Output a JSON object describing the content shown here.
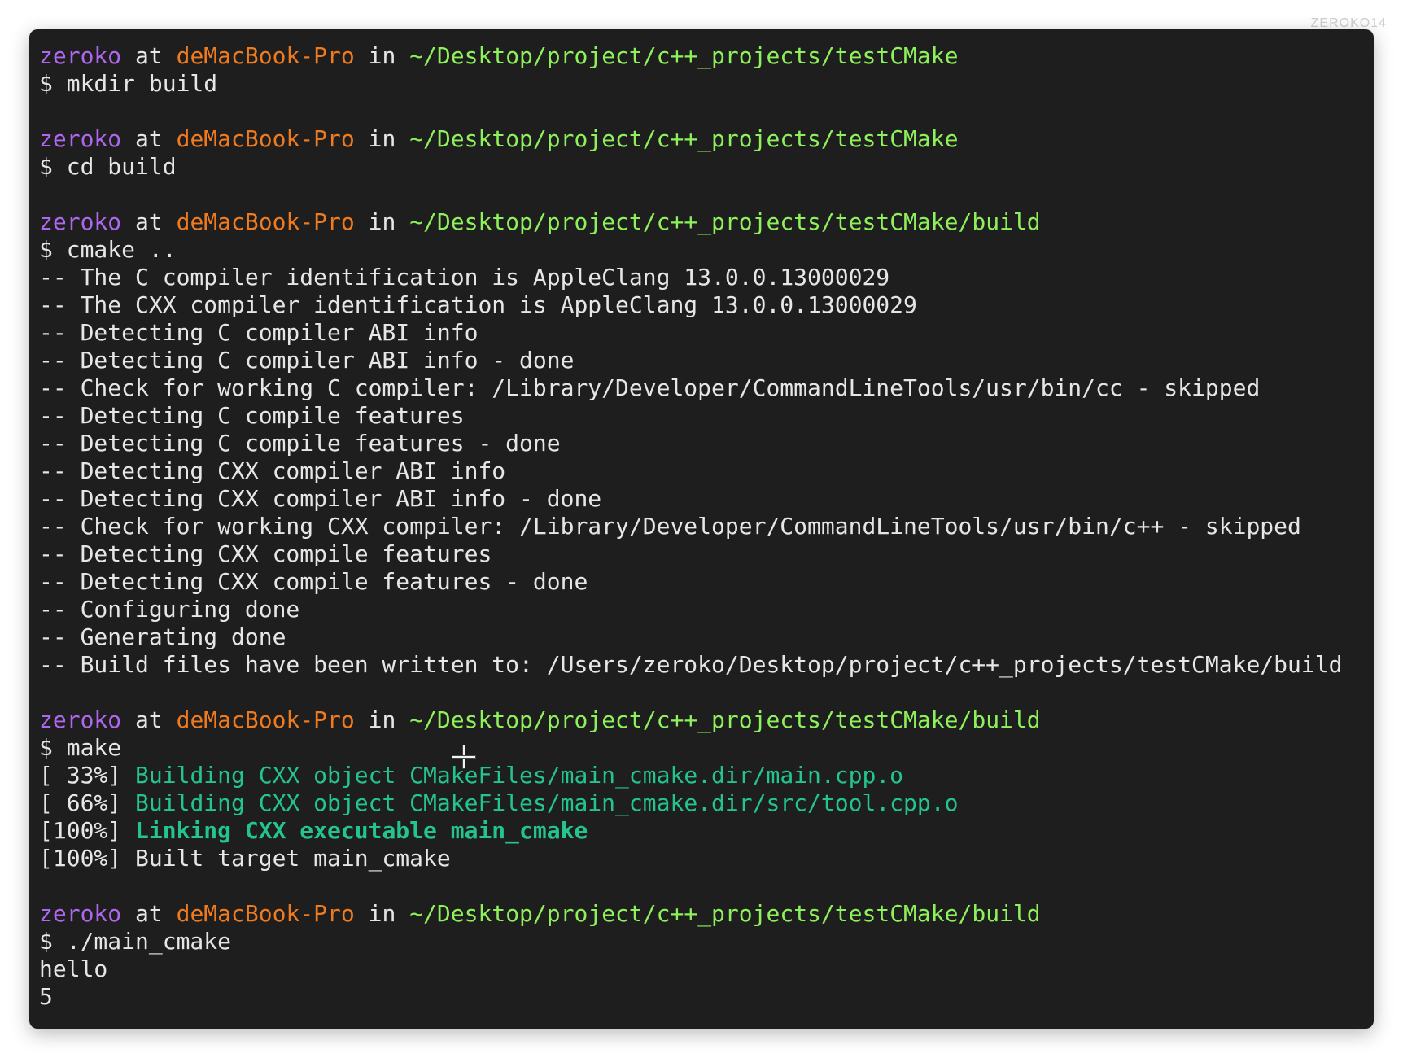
{
  "watermark": "ZEROKO14",
  "colors": {
    "background": "#1e1e1e",
    "user": "#b067f0",
    "host": "#f07b1e",
    "path": "#8ef05a",
    "text": "#e6e6e6",
    "build_step": "#23c48e"
  },
  "terminal": {
    "lines": [
      {
        "kind": "prompt",
        "user": "zeroko",
        "at": " at ",
        "host": "deMacBook-Pro",
        "in": " in ",
        "path": "~/Desktop/project/c++_projects/testCMake"
      },
      {
        "kind": "text",
        "text": "$ mkdir build"
      },
      {
        "kind": "blank"
      },
      {
        "kind": "prompt",
        "user": "zeroko",
        "at": " at ",
        "host": "deMacBook-Pro",
        "in": " in ",
        "path": "~/Desktop/project/c++_projects/testCMake"
      },
      {
        "kind": "text",
        "text": "$ cd build"
      },
      {
        "kind": "blank"
      },
      {
        "kind": "prompt",
        "user": "zeroko",
        "at": " at ",
        "host": "deMacBook-Pro",
        "in": " in ",
        "path": "~/Desktop/project/c++_projects/testCMake/build"
      },
      {
        "kind": "text",
        "text": "$ cmake .."
      },
      {
        "kind": "text",
        "text": "-- The C compiler identification is AppleClang 13.0.0.13000029"
      },
      {
        "kind": "text",
        "text": "-- The CXX compiler identification is AppleClang 13.0.0.13000029"
      },
      {
        "kind": "text",
        "text": "-- Detecting C compiler ABI info"
      },
      {
        "kind": "text",
        "text": "-- Detecting C compiler ABI info - done"
      },
      {
        "kind": "text",
        "text": "-- Check for working C compiler: /Library/Developer/CommandLineTools/usr/bin/cc - skipped"
      },
      {
        "kind": "text",
        "text": "-- Detecting C compile features"
      },
      {
        "kind": "text",
        "text": "-- Detecting C compile features - done"
      },
      {
        "kind": "text",
        "text": "-- Detecting CXX compiler ABI info"
      },
      {
        "kind": "text",
        "text": "-- Detecting CXX compiler ABI info - done"
      },
      {
        "kind": "text",
        "text": "-- Check for working CXX compiler: /Library/Developer/CommandLineTools/usr/bin/c++ - skipped"
      },
      {
        "kind": "text",
        "text": "-- Detecting CXX compile features"
      },
      {
        "kind": "text",
        "text": "-- Detecting CXX compile features - done"
      },
      {
        "kind": "text",
        "text": "-- Configuring done"
      },
      {
        "kind": "text",
        "text": "-- Generating done"
      },
      {
        "kind": "text",
        "text": "-- Build files have been written to: /Users/zeroko/Desktop/project/c++_projects/testCMake/build"
      },
      {
        "kind": "blank"
      },
      {
        "kind": "prompt",
        "user": "zeroko",
        "at": " at ",
        "host": "deMacBook-Pro",
        "in": " in ",
        "path": "~/Desktop/project/c++_projects/testCMake/build"
      },
      {
        "kind": "text",
        "text": "$ make"
      },
      {
        "kind": "build",
        "pct": "[ 33%] ",
        "msg": "Building CXX object CMakeFiles/main_cmake.dir/main.cpp.o",
        "bold": false
      },
      {
        "kind": "build",
        "pct": "[ 66%] ",
        "msg": "Building CXX object CMakeFiles/main_cmake.dir/src/tool.cpp.o",
        "bold": false
      },
      {
        "kind": "build",
        "pct": "[100%] ",
        "msg": "Linking CXX executable main_cmake",
        "bold": true
      },
      {
        "kind": "text",
        "text": "[100%] Built target main_cmake"
      },
      {
        "kind": "blank"
      },
      {
        "kind": "prompt",
        "user": "zeroko",
        "at": " at ",
        "host": "deMacBook-Pro",
        "in": " in ",
        "path": "~/Desktop/project/c++_projects/testCMake/build"
      },
      {
        "kind": "text",
        "text": "$ ./main_cmake"
      },
      {
        "kind": "text",
        "text": "hello"
      },
      {
        "kind": "text",
        "text": "5"
      }
    ]
  }
}
